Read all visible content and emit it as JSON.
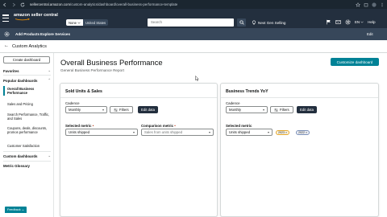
{
  "browser": {
    "url_host": "sellercentral.amazon.com",
    "url_path": "/custom-analytics/dashboard/overall-business-performance-template"
  },
  "topbar": {
    "logo_text": "amazon seller central",
    "store": "None",
    "region": "United States",
    "search_placeholder": "Search",
    "go_selling": "Next Gen Selling",
    "language": "EN",
    "help": "Help"
  },
  "menubar": {
    "items": [
      "Add Products",
      "Explore Services"
    ],
    "edit": "Edit"
  },
  "page": {
    "title": "Custom Analytics"
  },
  "sidebar": {
    "create_button": "Create dashboard",
    "sections": {
      "favorites": "Favorites",
      "popular": "Popular dashboards",
      "custom": "Custom dashboards",
      "glossary": "Metric Glossary"
    },
    "popular_items": [
      "Overall Business Performance",
      "Sales and Pricing",
      "Search Performance, Traffic, and Sales",
      "Coupons, deals, discounts, promos performance",
      "Customer Satisfaction"
    ],
    "feedback": "Feedback"
  },
  "main": {
    "title": "Overall Business Performance",
    "subtitle": "General Business Performance Report",
    "customize_button": "Customize dashboard"
  },
  "card_sales": {
    "title": "Sold Units & Sales",
    "cadence_label": "Cadence",
    "cadence_value": "Monthly",
    "filters_button": "Filters",
    "edit_button": "Edit data",
    "selected_metric_label": "Selected metric",
    "selected_metric_value": "Units shipped",
    "comparison_label": "Comparison metric",
    "comparison_placeholder": "Sales from units shipped"
  },
  "card_trends": {
    "title": "Business Trends YoY",
    "cadence_label": "Cadence",
    "cadence_value": "Monthly",
    "filters_button": "Filters",
    "edit_button": "Edit data",
    "selected_metric_label": "Selected metric",
    "selected_metric_value": "Units shipped",
    "chips": [
      "2023",
      "2022"
    ]
  },
  "colors": {
    "topbar": "#232f3e",
    "menubar": "#37475a",
    "accent": "#008296",
    "chip_2023": "#e4a72d",
    "chip_2022": "#7a8fb7"
  }
}
